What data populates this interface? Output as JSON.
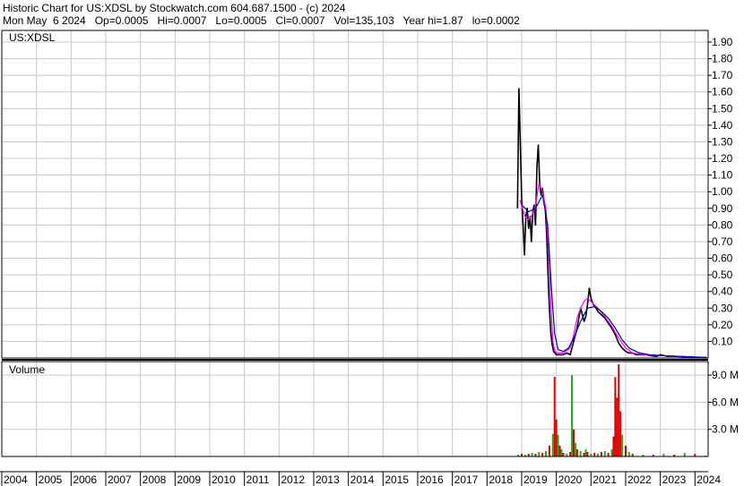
{
  "header": {
    "line1": "Historic Chart for US:XDSL by Stockwatch.com 604.687.1500 - (c) 2024",
    "line2": "Mon May  6 2024   Op=0.0005   Hi=0.0007   Lo=0.0005   Cl=0.0007   Vol=135,103   Year hi=1.87   lo=0.0002"
  },
  "price_panel": {
    "symbol_label": "US:XDSL"
  },
  "volume_panel": {
    "label": "Volume"
  },
  "colors": {
    "price_bar": "#000000",
    "ma_short": "#ff00ff",
    "ma_long": "#0000cc",
    "vol_up": "#22aa22",
    "vol_down": "#dd0000",
    "grid": "#c8c8c8"
  },
  "chart_data": [
    {
      "type": "line",
      "title": "US:XDSL",
      "y_ticks": [
        "0.10",
        "0.20",
        "0.30",
        "0.40",
        "0.50",
        "0.60",
        "0.70",
        "0.80",
        "0.90",
        "1.00",
        "1.10",
        "1.20",
        "1.30",
        "1.40",
        "1.50",
        "1.60",
        "1.70",
        "1.80",
        "1.90"
      ],
      "ylim": [
        0,
        1.97
      ],
      "x_ticks": [
        "2004",
        "2005",
        "2006",
        "2007",
        "2008",
        "2009",
        "2010",
        "2011",
        "2012",
        "2013",
        "2014",
        "2015",
        "2016",
        "2017",
        "2018",
        "2019",
        "2020",
        "2021",
        "2022",
        "2023",
        "2024"
      ],
      "xlim": [
        2004.0,
        2024.38
      ],
      "series": [
        {
          "role": "price",
          "x": [
            2018.88,
            2018.92,
            2018.96,
            2019.0,
            2019.04,
            2019.08,
            2019.12,
            2019.16,
            2019.2,
            2019.24,
            2019.28,
            2019.32,
            2019.36,
            2019.4,
            2019.44,
            2019.48,
            2019.52,
            2019.56,
            2019.6,
            2019.64,
            2019.68,
            2019.72,
            2019.76,
            2019.8,
            2019.84,
            2019.88,
            2019.92,
            2019.96,
            2020.0,
            2020.04,
            2020.08,
            2020.12,
            2020.2,
            2020.3,
            2020.4,
            2020.5,
            2020.6,
            2020.7,
            2020.8,
            2020.85,
            2020.9,
            2020.95,
            2021.0,
            2021.05,
            2021.1,
            2021.15,
            2021.2,
            2021.3,
            2021.4,
            2021.5,
            2021.6,
            2021.7,
            2021.8,
            2021.9,
            2022.0,
            2022.1,
            2022.2,
            2022.3,
            2022.4,
            2022.5,
            2022.6,
            2022.7,
            2022.8,
            2022.9,
            2023.0,
            2023.2,
            2023.4,
            2023.6,
            2023.8,
            2024.0,
            2024.2,
            2024.34
          ],
          "y": [
            0.9,
            1.62,
            1.3,
            0.95,
            0.8,
            0.62,
            0.85,
            0.9,
            0.78,
            0.85,
            0.7,
            0.88,
            0.92,
            0.8,
            1.15,
            1.28,
            1.05,
            0.98,
            1.02,
            0.95,
            0.9,
            0.75,
            0.5,
            0.3,
            0.15,
            0.08,
            0.04,
            0.03,
            0.02,
            0.02,
            0.02,
            0.02,
            0.02,
            0.03,
            0.02,
            0.1,
            0.18,
            0.3,
            0.22,
            0.25,
            0.32,
            0.42,
            0.36,
            0.33,
            0.31,
            0.3,
            0.28,
            0.26,
            0.24,
            0.21,
            0.18,
            0.14,
            0.09,
            0.06,
            0.04,
            0.03,
            0.03,
            0.02,
            0.02,
            0.02,
            0.02,
            0.015,
            0.012,
            0.01,
            0.02,
            0.01,
            0.01,
            0.008,
            0.006,
            0.004,
            0.002,
            0.0007
          ]
        },
        {
          "role": "ma_short",
          "x": [
            2018.95,
            2019.1,
            2019.2,
            2019.3,
            2019.4,
            2019.5,
            2019.6,
            2019.7,
            2019.8,
            2019.85,
            2019.9,
            2019.95,
            2020.0,
            2020.2,
            2020.4,
            2020.5,
            2020.6,
            2020.7,
            2020.8,
            2020.9,
            2021.0,
            2021.2,
            2021.4,
            2021.6,
            2021.8,
            2022.0,
            2022.2,
            2022.5,
            2023.0,
            2023.5,
            2024.0,
            2024.34
          ],
          "y": [
            0.95,
            0.85,
            0.83,
            0.86,
            0.92,
            1.05,
            1.0,
            0.9,
            0.55,
            0.3,
            0.1,
            0.05,
            0.03,
            0.03,
            0.06,
            0.14,
            0.24,
            0.3,
            0.34,
            0.36,
            0.34,
            0.3,
            0.25,
            0.19,
            0.12,
            0.06,
            0.03,
            0.02,
            0.015,
            0.01,
            0.005,
            0.003
          ]
        },
        {
          "role": "ma_long",
          "x": [
            2019.0,
            2019.2,
            2019.4,
            2019.6,
            2019.75,
            2019.85,
            2019.95,
            2020.05,
            2020.2,
            2020.35,
            2020.5,
            2020.7,
            2020.9,
            2021.1,
            2021.3,
            2021.5,
            2021.7,
            2021.9,
            2022.1,
            2022.4,
            2022.7,
            2023.0,
            2023.5,
            2024.0,
            2024.34
          ],
          "y": [
            0.92,
            0.88,
            0.9,
            0.98,
            0.8,
            0.45,
            0.15,
            0.05,
            0.04,
            0.06,
            0.12,
            0.22,
            0.3,
            0.31,
            0.28,
            0.24,
            0.18,
            0.11,
            0.06,
            0.03,
            0.02,
            0.015,
            0.01,
            0.006,
            0.004
          ]
        }
      ]
    },
    {
      "type": "bar",
      "title": "Volume",
      "y_ticks": [
        "3.0 M",
        "6.0 M",
        "9.0 M"
      ],
      "ylim": [
        0,
        10.5
      ],
      "x": [
        2018.9,
        2019.0,
        2019.1,
        2019.2,
        2019.3,
        2019.4,
        2019.5,
        2019.6,
        2019.7,
        2019.8,
        2019.9,
        2019.95,
        2020.0,
        2020.05,
        2020.1,
        2020.15,
        2020.2,
        2020.3,
        2020.4,
        2020.45,
        2020.5,
        2020.55,
        2020.6,
        2020.7,
        2020.8,
        2020.85,
        2020.9,
        2021.0,
        2021.1,
        2021.2,
        2021.3,
        2021.4,
        2021.5,
        2021.6,
        2021.65,
        2021.7,
        2021.75,
        2021.8,
        2021.85,
        2021.9,
        2022.0,
        2022.1,
        2022.2,
        2022.5,
        2022.8,
        2023.1,
        2023.4,
        2023.7,
        2024.0,
        2024.3
      ],
      "values": [
        0.2,
        0.3,
        0.2,
        0.3,
        0.4,
        0.3,
        0.5,
        0.4,
        0.6,
        1.2,
        2.5,
        8.8,
        4.1,
        2.4,
        1.2,
        0.8,
        0.4,
        0.3,
        0.5,
        9.0,
        3.0,
        1.5,
        0.8,
        0.6,
        0.4,
        0.8,
        0.5,
        0.3,
        0.4,
        0.3,
        0.5,
        0.6,
        0.4,
        0.8,
        2.2,
        8.8,
        6.5,
        10.2,
        5.0,
        2.4,
        1.2,
        0.5,
        0.3,
        0.2,
        0.2,
        0.3,
        0.2,
        0.4,
        0.3,
        0.1
      ],
      "up": [
        true,
        false,
        true,
        false,
        true,
        false,
        true,
        false,
        true,
        false,
        true,
        false,
        false,
        true,
        false,
        true,
        false,
        true,
        false,
        true,
        false,
        true,
        false,
        true,
        false,
        true,
        false,
        true,
        false,
        true,
        false,
        true,
        false,
        true,
        false,
        false,
        false,
        false,
        false,
        true,
        false,
        true,
        false,
        true,
        false,
        true,
        false,
        true,
        false,
        true
      ]
    }
  ]
}
